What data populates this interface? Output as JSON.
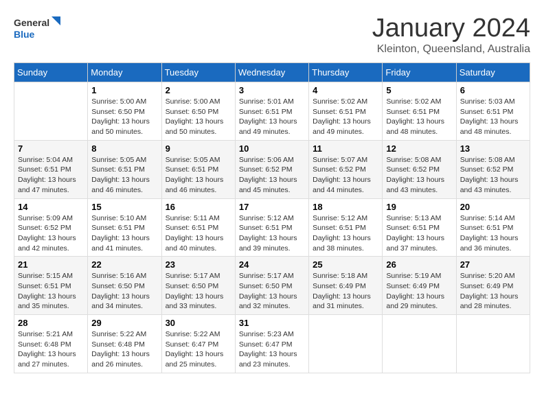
{
  "header": {
    "logo_line1": "General",
    "logo_line2": "Blue",
    "title": "January 2024",
    "subtitle": "Kleinton, Queensland, Australia"
  },
  "columns": [
    "Sunday",
    "Monday",
    "Tuesday",
    "Wednesday",
    "Thursday",
    "Friday",
    "Saturday"
  ],
  "weeks": [
    [
      {
        "day": "",
        "info": ""
      },
      {
        "day": "1",
        "info": "Sunrise: 5:00 AM\nSunset: 6:50 PM\nDaylight: 13 hours\nand 50 minutes."
      },
      {
        "day": "2",
        "info": "Sunrise: 5:00 AM\nSunset: 6:50 PM\nDaylight: 13 hours\nand 50 minutes."
      },
      {
        "day": "3",
        "info": "Sunrise: 5:01 AM\nSunset: 6:51 PM\nDaylight: 13 hours\nand 49 minutes."
      },
      {
        "day": "4",
        "info": "Sunrise: 5:02 AM\nSunset: 6:51 PM\nDaylight: 13 hours\nand 49 minutes."
      },
      {
        "day": "5",
        "info": "Sunrise: 5:02 AM\nSunset: 6:51 PM\nDaylight: 13 hours\nand 48 minutes."
      },
      {
        "day": "6",
        "info": "Sunrise: 5:03 AM\nSunset: 6:51 PM\nDaylight: 13 hours\nand 48 minutes."
      }
    ],
    [
      {
        "day": "7",
        "info": "Sunrise: 5:04 AM\nSunset: 6:51 PM\nDaylight: 13 hours\nand 47 minutes."
      },
      {
        "day": "8",
        "info": "Sunrise: 5:05 AM\nSunset: 6:51 PM\nDaylight: 13 hours\nand 46 minutes."
      },
      {
        "day": "9",
        "info": "Sunrise: 5:05 AM\nSunset: 6:51 PM\nDaylight: 13 hours\nand 46 minutes."
      },
      {
        "day": "10",
        "info": "Sunrise: 5:06 AM\nSunset: 6:52 PM\nDaylight: 13 hours\nand 45 minutes."
      },
      {
        "day": "11",
        "info": "Sunrise: 5:07 AM\nSunset: 6:52 PM\nDaylight: 13 hours\nand 44 minutes."
      },
      {
        "day": "12",
        "info": "Sunrise: 5:08 AM\nSunset: 6:52 PM\nDaylight: 13 hours\nand 43 minutes."
      },
      {
        "day": "13",
        "info": "Sunrise: 5:08 AM\nSunset: 6:52 PM\nDaylight: 13 hours\nand 43 minutes."
      }
    ],
    [
      {
        "day": "14",
        "info": "Sunrise: 5:09 AM\nSunset: 6:52 PM\nDaylight: 13 hours\nand 42 minutes."
      },
      {
        "day": "15",
        "info": "Sunrise: 5:10 AM\nSunset: 6:51 PM\nDaylight: 13 hours\nand 41 minutes."
      },
      {
        "day": "16",
        "info": "Sunrise: 5:11 AM\nSunset: 6:51 PM\nDaylight: 13 hours\nand 40 minutes."
      },
      {
        "day": "17",
        "info": "Sunrise: 5:12 AM\nSunset: 6:51 PM\nDaylight: 13 hours\nand 39 minutes."
      },
      {
        "day": "18",
        "info": "Sunrise: 5:12 AM\nSunset: 6:51 PM\nDaylight: 13 hours\nand 38 minutes."
      },
      {
        "day": "19",
        "info": "Sunrise: 5:13 AM\nSunset: 6:51 PM\nDaylight: 13 hours\nand 37 minutes."
      },
      {
        "day": "20",
        "info": "Sunrise: 5:14 AM\nSunset: 6:51 PM\nDaylight: 13 hours\nand 36 minutes."
      }
    ],
    [
      {
        "day": "21",
        "info": "Sunrise: 5:15 AM\nSunset: 6:51 PM\nDaylight: 13 hours\nand 35 minutes."
      },
      {
        "day": "22",
        "info": "Sunrise: 5:16 AM\nSunset: 6:50 PM\nDaylight: 13 hours\nand 34 minutes."
      },
      {
        "day": "23",
        "info": "Sunrise: 5:17 AM\nSunset: 6:50 PM\nDaylight: 13 hours\nand 33 minutes."
      },
      {
        "day": "24",
        "info": "Sunrise: 5:17 AM\nSunset: 6:50 PM\nDaylight: 13 hours\nand 32 minutes."
      },
      {
        "day": "25",
        "info": "Sunrise: 5:18 AM\nSunset: 6:49 PM\nDaylight: 13 hours\nand 31 minutes."
      },
      {
        "day": "26",
        "info": "Sunrise: 5:19 AM\nSunset: 6:49 PM\nDaylight: 13 hours\nand 29 minutes."
      },
      {
        "day": "27",
        "info": "Sunrise: 5:20 AM\nSunset: 6:49 PM\nDaylight: 13 hours\nand 28 minutes."
      }
    ],
    [
      {
        "day": "28",
        "info": "Sunrise: 5:21 AM\nSunset: 6:48 PM\nDaylight: 13 hours\nand 27 minutes."
      },
      {
        "day": "29",
        "info": "Sunrise: 5:22 AM\nSunset: 6:48 PM\nDaylight: 13 hours\nand 26 minutes."
      },
      {
        "day": "30",
        "info": "Sunrise: 5:22 AM\nSunset: 6:47 PM\nDaylight: 13 hours\nand 25 minutes."
      },
      {
        "day": "31",
        "info": "Sunrise: 5:23 AM\nSunset: 6:47 PM\nDaylight: 13 hours\nand 23 minutes."
      },
      {
        "day": "",
        "info": ""
      },
      {
        "day": "",
        "info": ""
      },
      {
        "day": "",
        "info": ""
      }
    ]
  ]
}
